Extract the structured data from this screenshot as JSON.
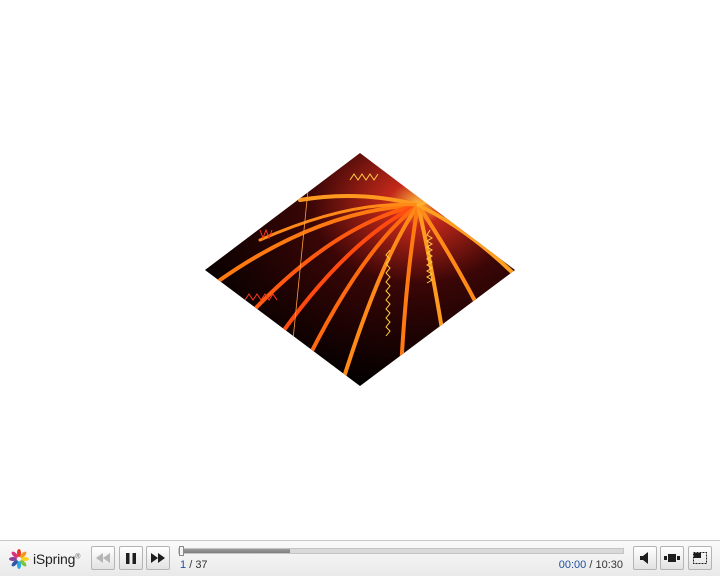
{
  "slide": {
    "current": "1",
    "separator": "/",
    "total": "37"
  },
  "playback": {
    "elapsed": "00:00",
    "separator": "/",
    "duration": "10:30",
    "buffered_fraction": 0.25,
    "played_fraction": 0.0,
    "state": "playing"
  },
  "logo": {
    "text": "iSpring",
    "mark": "®"
  },
  "controls": {
    "previous_icon": "rewind-icon",
    "pause_icon": "pause-icon",
    "next_icon": "fast-forward-icon",
    "volume_icon": "speaker-icon",
    "layout_icon": "layout-icon",
    "fullscreen_icon": "fullscreen-icon"
  },
  "colors": {
    "accent": "#1f4fa0",
    "bar_background": "#eeeeee",
    "slide_dark": "#1a0505",
    "slide_orange": "#ff8c1a"
  }
}
